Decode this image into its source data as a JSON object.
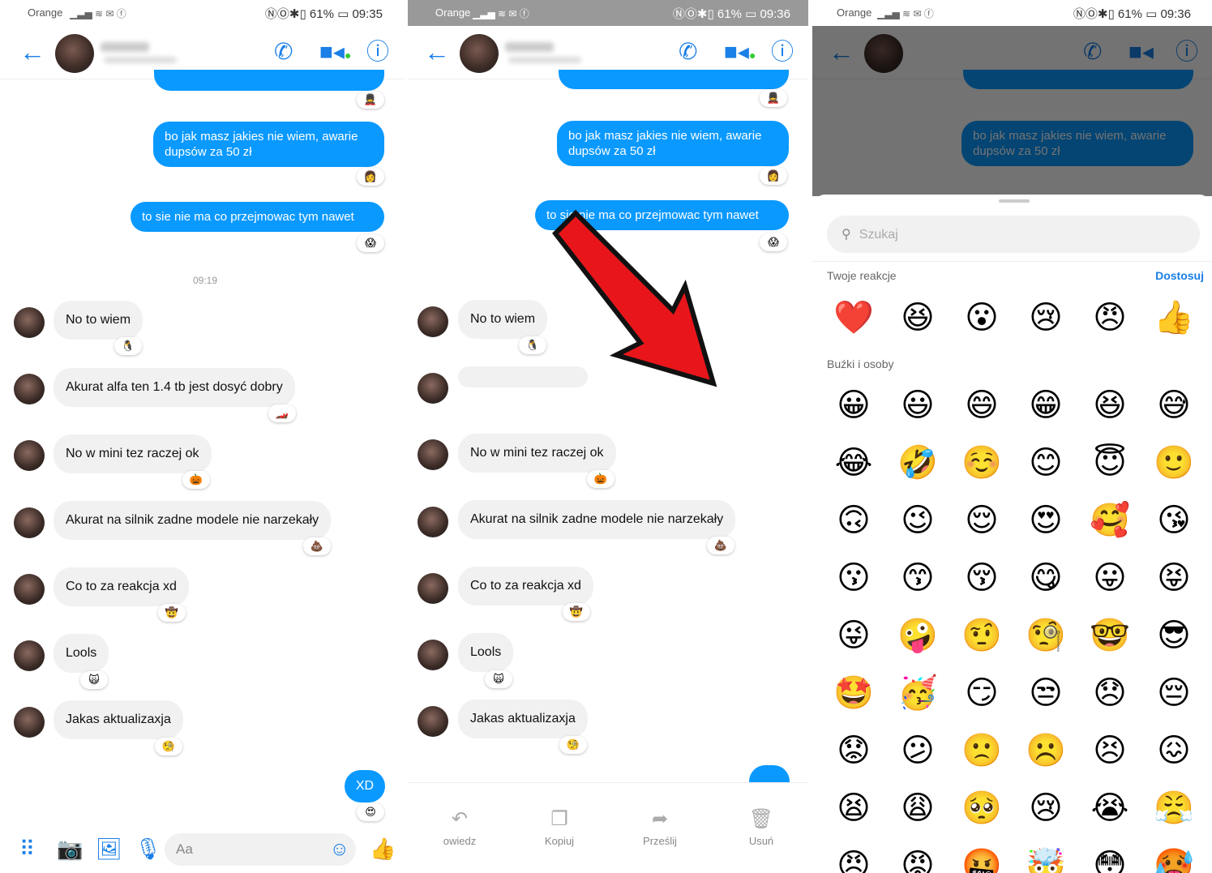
{
  "status": {
    "carrier": "Orange",
    "battery": "61%",
    "time1": "09:35",
    "time2": "09:36",
    "time3": "09:36"
  },
  "chat": {
    "out1": "bo jak masz jakies nie wiem, awarie dupsów za 50 zł",
    "out2": "to sie nie ma co przejmowac tym nawet",
    "timestamp": "09:19",
    "in1": "No to wiem",
    "in2": "Akurat alfa ten 1.4 tb jest dosyć dobry",
    "in3": "No w mini tez raczej ok",
    "in4": "Akurat na silnik zadne modele nie narzekały",
    "in5": "Co to za reakcja xd",
    "in6": "Lools",
    "in7": "Jakas aktualizaxja",
    "out3": "XD",
    "composer_placeholder": "Aa"
  },
  "reactions_bar": [
    "❤️",
    "😆",
    "😮",
    "😢",
    "😠",
    "👍"
  ],
  "actions": {
    "reply": "owiedz",
    "copy": "Kopiuj",
    "forward": "Prześlij",
    "delete": "Usuń"
  },
  "picker": {
    "search_placeholder": "Szukaj",
    "your_reactions": "Twoje reakcje",
    "customize": "Dostosuj",
    "faces_section": "Buźki i osoby",
    "your": [
      "❤️",
      "😆",
      "😮",
      "😢",
      "😠",
      "👍"
    ],
    "faces": [
      "😀",
      "😃",
      "😄",
      "😁",
      "😆",
      "😅",
      "😂",
      "🤣",
      "☺️",
      "😊",
      "😇",
      "🙂",
      "🙃",
      "😉",
      "😌",
      "😍",
      "🥰",
      "😘",
      "😗",
      "😙",
      "😚",
      "😋",
      "😛",
      "😝",
      "😜",
      "🤪",
      "🤨",
      "🧐",
      "🤓",
      "😎",
      "🤩",
      "🥳",
      "😏",
      "😒",
      "😞",
      "😔",
      "😟",
      "😕",
      "🙁",
      "☹️",
      "😣",
      "😖",
      "😫",
      "😩",
      "🥺",
      "😢",
      "😭",
      "😤",
      "😠",
      "😡",
      "🤬",
      "🤯",
      "😳",
      "🥵"
    ]
  },
  "colors": {
    "accent": "#0a99ff",
    "header_icons": "#1a7fe6",
    "incoming": "#f1f1f1"
  }
}
